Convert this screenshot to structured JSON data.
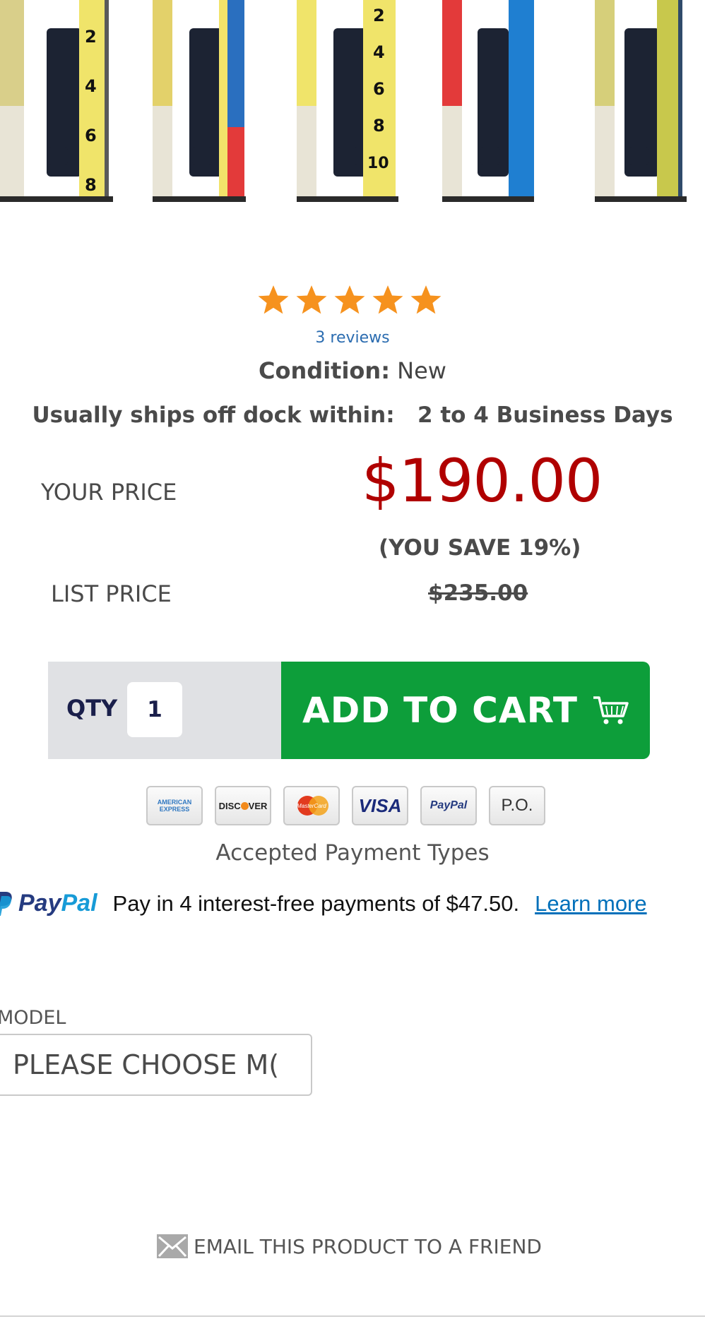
{
  "rating": {
    "stars": 5,
    "max_stars": 5,
    "reviews_link": "3 reviews",
    "star_color": "#f6921e"
  },
  "condition": {
    "label": "Condition:",
    "value": "New"
  },
  "shipping": {
    "label": "Usually ships off dock within:",
    "value": "2 to 4 Business Days"
  },
  "pricing": {
    "your_price_label": "YOUR PRICE",
    "your_price": "$190.00",
    "you_save": "(YOU SAVE 19%)",
    "list_price_label": "LIST PRICE",
    "list_price": "$235.00",
    "price_color": "#b00000"
  },
  "cart": {
    "qty_label": "QTY",
    "qty_value": "1",
    "add_to_cart_label": "ADD TO CART",
    "button_color": "#0d9e3a"
  },
  "payments": {
    "cards": [
      {
        "name": "amex",
        "label1": "AMERICAN",
        "label2": "EXPRESS"
      },
      {
        "name": "discover",
        "label1": "DISC",
        "label2": "VER"
      },
      {
        "name": "mastercard",
        "label": "MasterCard"
      },
      {
        "name": "visa",
        "label": "VISA"
      },
      {
        "name": "paypal",
        "label": "PayPal"
      },
      {
        "name": "po",
        "label": "P.O."
      }
    ],
    "caption": "Accepted Payment Types"
  },
  "paypal_offer": {
    "logo_pay": "Pay",
    "logo_pal": "Pal",
    "text": "Pay in 4 interest-free payments of $47.50.",
    "link": "Learn more"
  },
  "model": {
    "label": "MODEL",
    "placeholder": "PLEASE CHOOSE M("
  },
  "email_friend": {
    "label": "EMAIL THIS PRODUCT TO A FRIEND"
  },
  "hero_rods": [
    {
      "numbers": [
        "2",
        "4",
        "6",
        "8"
      ],
      "scale_color": "#f3e46a"
    },
    {
      "numbers": [],
      "scale_color": "#2a6fbf"
    },
    {
      "numbers": [
        "2",
        "4",
        "6",
        "8",
        "10"
      ],
      "scale_color": "#f3e46a"
    },
    {
      "numbers": [],
      "scale_color": "#1f7fd1"
    },
    {
      "numbers": [],
      "scale_color": "#c8c84c"
    }
  ]
}
